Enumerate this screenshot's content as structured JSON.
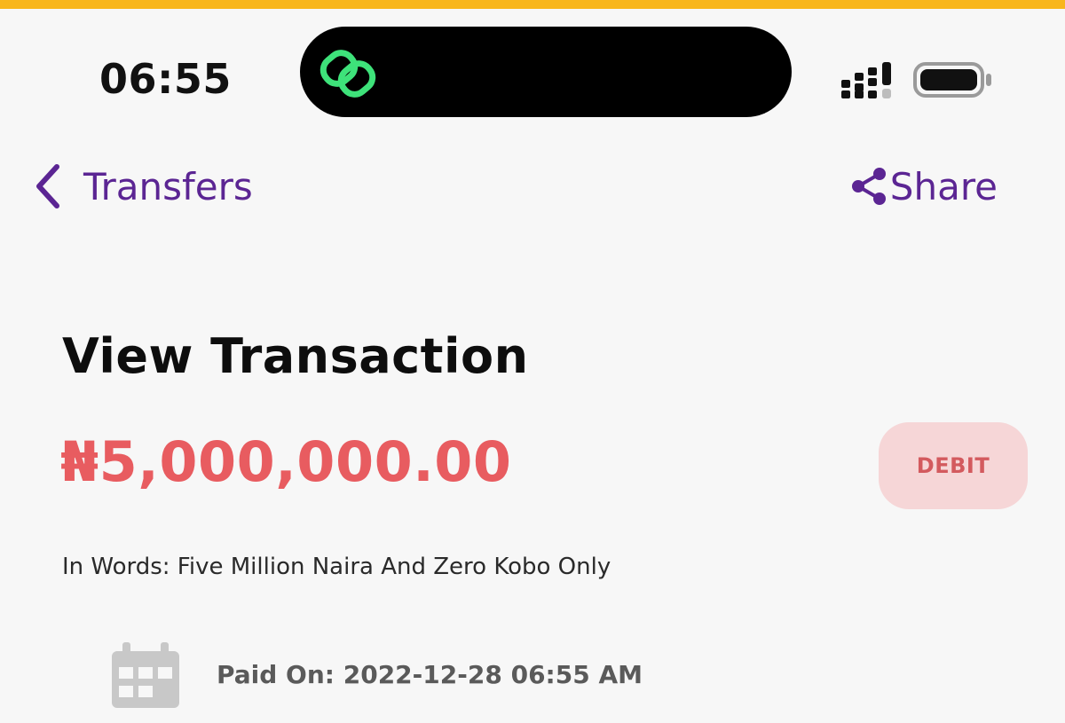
{
  "colors": {
    "accent_bar": "#f8b61c",
    "brand_purple": "#5b2593",
    "amount_red": "#e85c60",
    "debit_badge_bg": "#f6d6d7",
    "island_icon_green": "#3ee27a"
  },
  "status_bar": {
    "time": "06:55",
    "island_icon": "linked-rings-icon",
    "signal_icon": "cellular-signal-icon",
    "battery_icon": "battery-icon"
  },
  "nav": {
    "back_icon": "chevron-left-icon",
    "back_label": "Transfers",
    "share_icon": "share-icon",
    "share_label": "Share"
  },
  "transaction": {
    "title": "View Transaction",
    "amount": "₦5,000,000.00",
    "type_badge": "DEBIT",
    "amount_in_words": "In Words: Five Million Naira And Zero Kobo Only",
    "paid_icon": "calendar-icon",
    "paid_on": "Paid On: 2022-12-28 06:55 AM"
  }
}
